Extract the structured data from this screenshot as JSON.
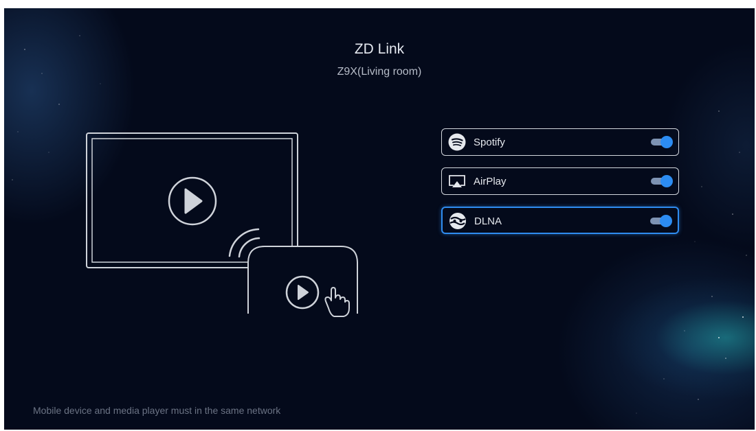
{
  "app": {
    "title": "ZD Link",
    "device": "Z9X(Living room)"
  },
  "options": [
    {
      "label": "Spotify",
      "icon": "spotify-icon",
      "enabled": true,
      "focused": false
    },
    {
      "label": "AirPlay",
      "icon": "airplay-icon",
      "enabled": true,
      "focused": false
    },
    {
      "label": "DLNA",
      "icon": "dlna-icon",
      "enabled": true,
      "focused": true
    }
  ],
  "footer": {
    "note": "Mobile device and media player must in the same network"
  },
  "colors": {
    "background": "#040a1b",
    "accent": "#2c8cf2",
    "toggle_track": "#7e93b3"
  }
}
